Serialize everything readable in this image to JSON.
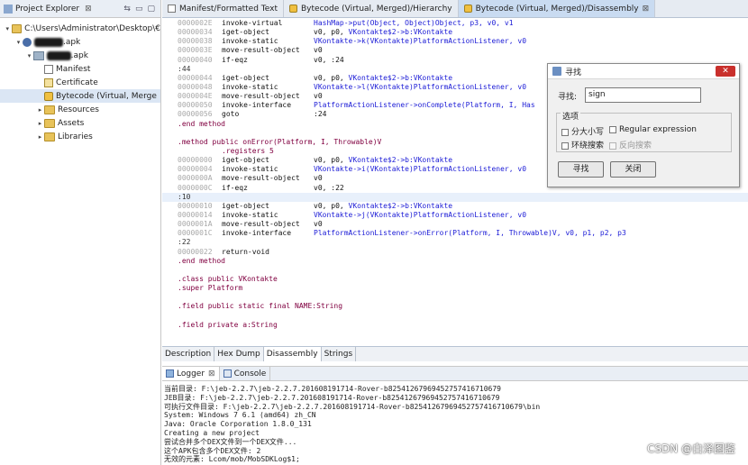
{
  "explorer": {
    "title": "Project Explorer",
    "close": "⊠",
    "items": [
      {
        "label": "C:\\Users\\Administrator\\Desktop\\€",
        "depth": 0,
        "expander": "▾",
        "icon": "folder"
      },
      {
        "label": "1.apk",
        "depth": 1,
        "expander": "▾",
        "icon": "disk",
        "blurred": "xxxxxx"
      },
      {
        "label": "1.apk",
        "depth": 2,
        "expander": "▾",
        "icon": "apk",
        "blurred": "xxxxx"
      },
      {
        "label": "Manifest",
        "depth": 3,
        "expander": "",
        "icon": "doc"
      },
      {
        "label": "Certificate",
        "depth": 3,
        "expander": "",
        "icon": "cert"
      },
      {
        "label": "Bytecode (Virtual, Merge",
        "depth": 3,
        "expander": "",
        "icon": "bc"
      },
      {
        "label": "Resources",
        "depth": 3,
        "expander": "▸",
        "icon": "folder"
      },
      {
        "label": "Assets",
        "depth": 3,
        "expander": "▸",
        "icon": "folder"
      },
      {
        "label": "Libraries",
        "depth": 3,
        "expander": "▸",
        "icon": "folder"
      }
    ]
  },
  "editor_tabs": [
    {
      "label": "Manifest/Formatted Text",
      "icon": "page",
      "close": ""
    },
    {
      "label": "Bytecode (Virtual, Merged)/Hierarchy",
      "icon": "bc",
      "close": ""
    },
    {
      "label": "Bytecode (Virtual, Merged)/Disassembly",
      "icon": "bc",
      "close": "⊠"
    }
  ],
  "code_lines": [
    {
      "type": "ins",
      "addr": "0000002E",
      "op": "invoke-virtual",
      "args": [
        [
          "HashMap->put(Object, Object)Object, p3, v0, v1",
          "cls"
        ]
      ]
    },
    {
      "type": "ins",
      "addr": "00000034",
      "op": "iget-object",
      "args": [
        [
          "v0, p0, ",
          ""
        ],
        [
          "VKontakte$2->b:VKontakte",
          "cls"
        ]
      ]
    },
    {
      "type": "ins",
      "addr": "00000038",
      "op": "invoke-static",
      "args": [
        [
          "VKontakte->k(VKontakte)PlatformActionListener, v0",
          "cls"
        ]
      ]
    },
    {
      "type": "ins",
      "addr": "0000003E",
      "op": "move-result-object",
      "args": [
        [
          "v0",
          ""
        ]
      ]
    },
    {
      "type": "ins",
      "addr": "00000040",
      "op": "if-eqz",
      "args": [
        [
          "v0, :24",
          ""
        ]
      ]
    },
    {
      "type": "label",
      "text": ":44"
    },
    {
      "type": "ins",
      "addr": "00000044",
      "op": "iget-object",
      "args": [
        [
          "v0, p0, ",
          ""
        ],
        [
          "VKontakte$2->b:VKontakte",
          "cls"
        ]
      ]
    },
    {
      "type": "ins",
      "addr": "00000048",
      "op": "invoke-static",
      "args": [
        [
          "VKontakte->l(VKontakte)PlatformActionListener, v0",
          "cls"
        ]
      ]
    },
    {
      "type": "ins",
      "addr": "0000004E",
      "op": "move-result-object",
      "args": [
        [
          "v0",
          ""
        ]
      ]
    },
    {
      "type": "ins",
      "addr": "00000050",
      "op": "invoke-interface",
      "args": [
        [
          "PlatformActionListener->onComplete(Platform, I, Has",
          "cls"
        ]
      ]
    },
    {
      "type": "ins",
      "addr": "00000056",
      "op": "goto",
      "args": [
        [
          ":24",
          ""
        ]
      ]
    },
    {
      "type": "dir",
      "text": ".end method"
    },
    {
      "type": "blank",
      "text": ""
    },
    {
      "type": "dir",
      "text": ".method public onError(Platform, I, Throwable)V"
    },
    {
      "type": "sub",
      "text": ".registers 5"
    },
    {
      "type": "ins",
      "addr": "00000000",
      "op": "iget-object",
      "args": [
        [
          "v0, p0, ",
          ""
        ],
        [
          "VKontakte$2->b:VKontakte",
          "cls"
        ]
      ]
    },
    {
      "type": "ins",
      "addr": "00000004",
      "op": "invoke-static",
      "args": [
        [
          "VKontakte->i(VKontakte)PlatformActionListener, v0",
          "cls"
        ]
      ]
    },
    {
      "type": "ins",
      "addr": "0000000A",
      "op": "move-result-object",
      "args": [
        [
          "v0",
          ""
        ]
      ]
    },
    {
      "type": "ins",
      "addr": "0000000C",
      "op": "if-eqz",
      "args": [
        [
          "v0, :22",
          ""
        ]
      ]
    },
    {
      "type": "label",
      "text": ":10",
      "hl": true
    },
    {
      "type": "ins",
      "addr": "00000010",
      "op": "iget-object",
      "args": [
        [
          "v0, p0, ",
          ""
        ],
        [
          "VKontakte$2->b:VKontakte",
          "cls"
        ]
      ]
    },
    {
      "type": "ins",
      "addr": "00000014",
      "op": "invoke-static",
      "args": [
        [
          "VKontakte->j(VKontakte)PlatformActionListener, v0",
          "cls"
        ]
      ]
    },
    {
      "type": "ins",
      "addr": "0000001A",
      "op": "move-result-object",
      "args": [
        [
          "v0",
          ""
        ]
      ]
    },
    {
      "type": "ins",
      "addr": "0000001C",
      "op": "invoke-interface",
      "args": [
        [
          "PlatformActionListener->onError(Platform, I, Throwable)V, v0, p1, p2, p3",
          "cls"
        ]
      ]
    },
    {
      "type": "label",
      "text": ":22"
    },
    {
      "type": "ins",
      "addr": "00000022",
      "op": "return-void",
      "args": []
    },
    {
      "type": "dir",
      "text": ".end method"
    },
    {
      "type": "blank",
      "text": ""
    },
    {
      "type": "dir",
      "text": ".class public VKontakte"
    },
    {
      "type": "dir",
      "text": ".super Platform"
    },
    {
      "type": "blank",
      "text": ""
    },
    {
      "type": "dir",
      "text": ".field public static final NAME:String"
    },
    {
      "type": "blank",
      "text": ""
    },
    {
      "type": "dir",
      "text": ".field private a:String"
    }
  ],
  "bottom_tabs": [
    "Description",
    "Hex Dump",
    "Disassembly",
    "Strings"
  ],
  "bottom_active": 2,
  "logger": {
    "tabs": [
      {
        "label": "Logger",
        "close": "⊠"
      },
      {
        "label": "Console",
        "close": ""
      }
    ],
    "lines": [
      "当前目录: F:\\jeb-2.2.7\\jeb-2.2.7.201608191714-Rover-b82541267969452757416710679",
      "JEB目录: F:\\jeb-2.2.7\\jeb-2.2.7.201608191714-Rover-b82541267969452757416710679",
      "可执行文件目录: F:\\jeb-2.2.7\\jeb-2.2.7.201608191714-Rover-b82541267969452757416710679\\bin",
      "System: Windows 7 6.1 (amd64) zh_CN",
      "Java: Oracle Corporation 1.8.0_131",
      "Creating a new project",
      "尝试合并多个DEX文件到一个DEX文件...",
      "这个APK包含多个DEX文件: 2",
      "无效的元素: Lcom/mob/MobSDKLog$1;"
    ]
  },
  "find_dialog": {
    "title": "寻找",
    "close": "✕",
    "find_label": "寻找:",
    "find_value": "sign",
    "options_label": "选项",
    "opt_case": "分大小写",
    "opt_regex": "Regular expression",
    "opt_wrap": "环绕搜索",
    "opt_reverse": "反向搜索",
    "btn_find": "寻找",
    "btn_close": "关闭"
  },
  "watermark": "CSDN @白泽图鉴"
}
